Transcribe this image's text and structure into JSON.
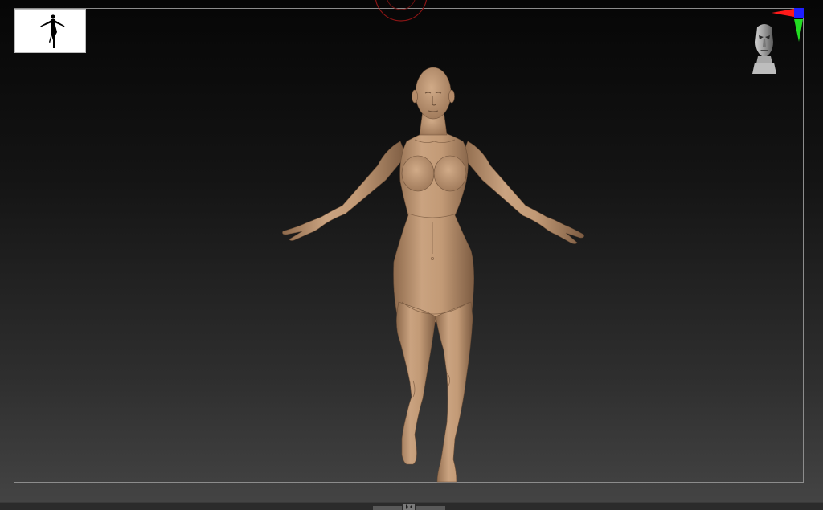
{
  "viewport": {
    "background_top": "#060606",
    "background_bottom": "#454545",
    "frame_color": "#8c8c8c"
  },
  "navigation": {
    "silhouette_icon": "female-silhouette-icon",
    "head_gizmo_icon": "head-orientation-icon",
    "axis_icon": "xyz-axis-icon"
  },
  "model": {
    "type": "female-base-mesh",
    "skin_color": "#c9a27f",
    "shadow_color": "#8f6b4e"
  },
  "axis_colors": {
    "x": "#ff1a1a",
    "y": "#22dd22",
    "z": "#1f1fff"
  },
  "brush": {
    "color": "#9a1a1a"
  }
}
